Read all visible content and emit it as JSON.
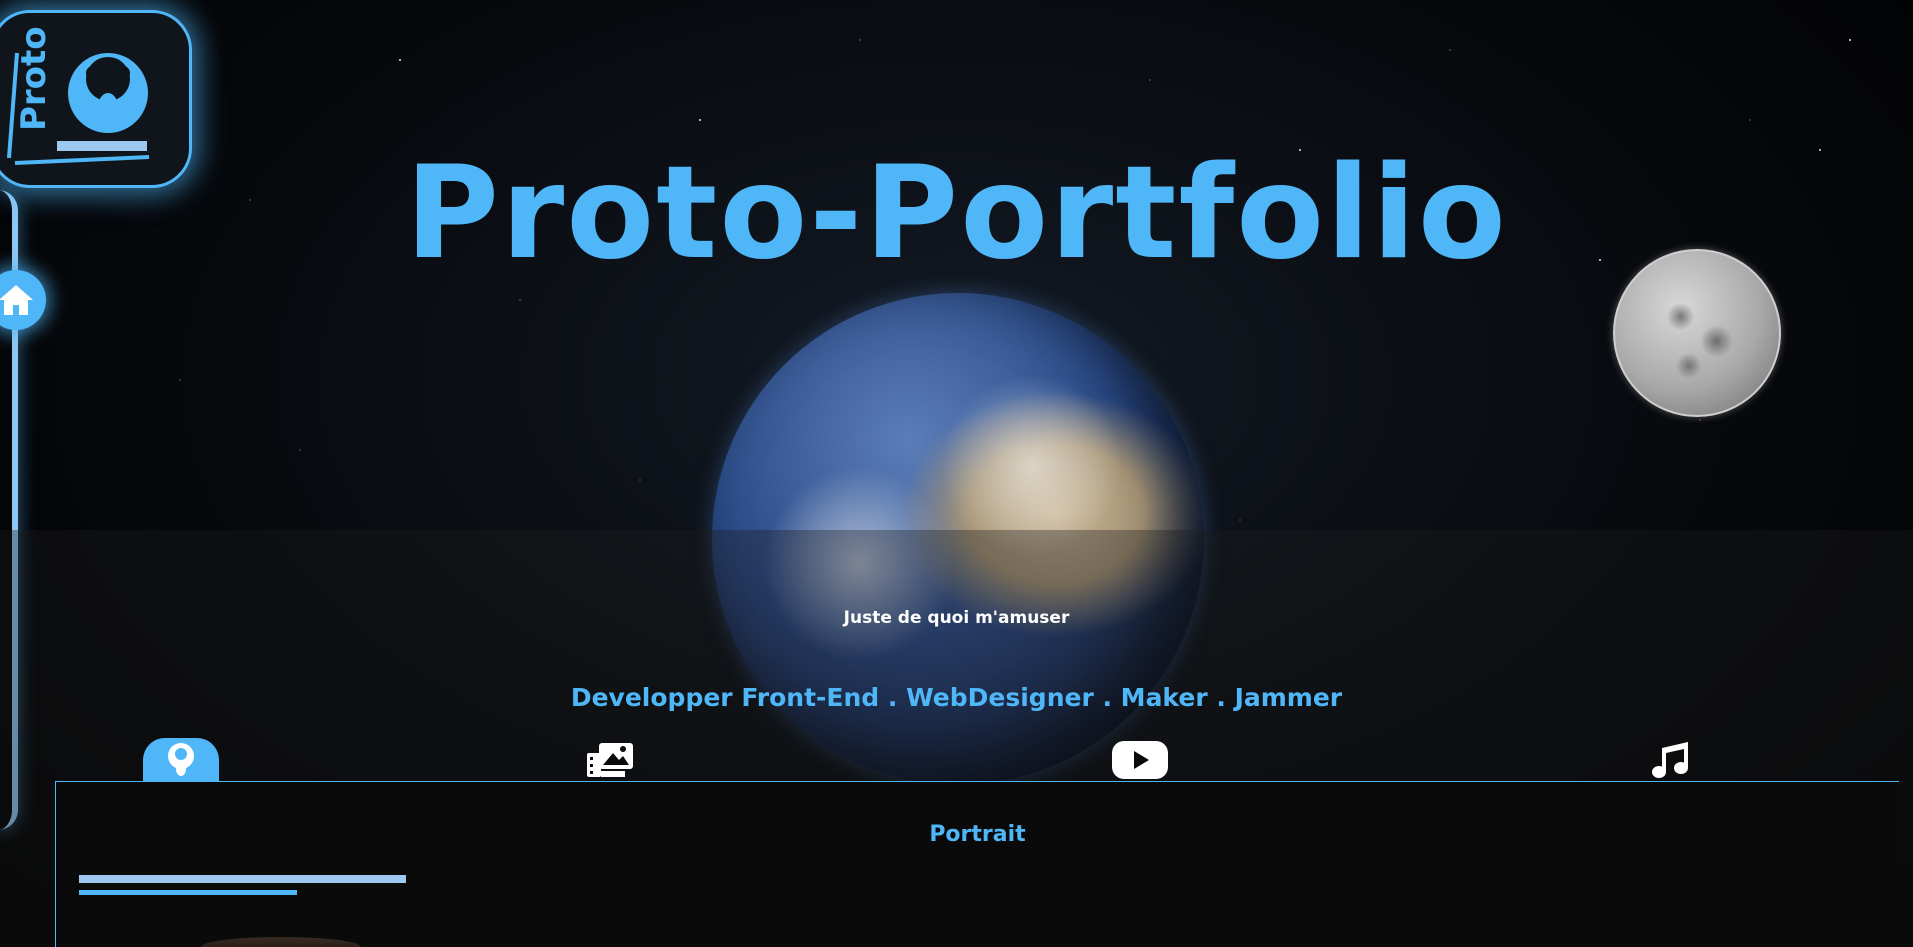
{
  "header": {
    "title": "Proto-Portfolio"
  },
  "logo": {
    "text": "Proto",
    "icon": "afro-portrait-icon"
  },
  "nav": {
    "home_icon": "home-icon"
  },
  "hero": {
    "tagline": "Juste de quoi m'amuser",
    "roles": "Developper Front-End . WebDesigner . Maker . Jammer"
  },
  "tabs": [
    {
      "icon": "portrait-icon",
      "active": true
    },
    {
      "icon": "photo-gallery-icon",
      "active": false
    },
    {
      "icon": "youtube-play-icon",
      "active": false
    },
    {
      "icon": "music-note-icon",
      "active": false
    }
  ],
  "panel": {
    "title": "Portrait"
  },
  "colors": {
    "accent": "#4fb6f7",
    "accent_light": "#9dc8f0",
    "background": "#000000",
    "text_white": "#ffffff"
  }
}
